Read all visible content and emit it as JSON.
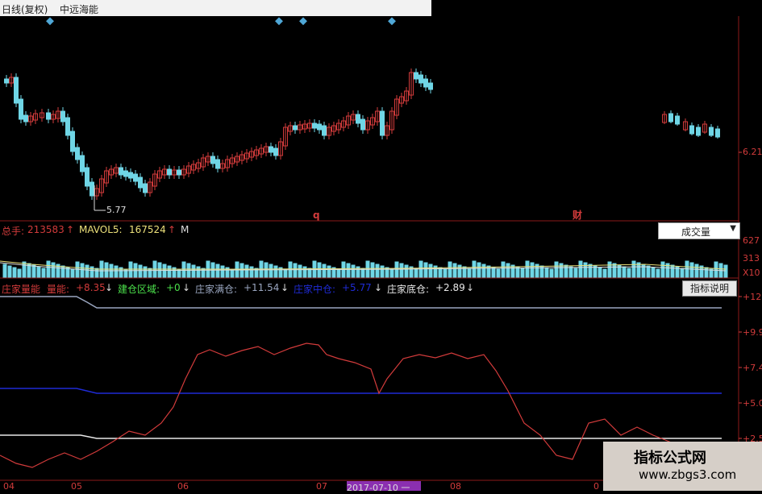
{
  "header": {
    "chart_mode": "日线(复权)",
    "stock_name": "中远海能"
  },
  "main_chart": {
    "low_price_label": "5.77",
    "marker_q": "q",
    "marker_cai": "财",
    "axis_price": "6.21"
  },
  "volume_panel": {
    "total_label": "总手:",
    "total_value": "213583",
    "mavol_label": "MAVOL5:",
    "mavol_value": "167524",
    "m_label": "M",
    "indicator_select": "成交量",
    "axis_top": "627",
    "axis_mid": "313",
    "axis_unit": "X10"
  },
  "indicator_panel": {
    "title": "庄家量能",
    "energy_label": "量能:",
    "energy_value": "+8.35",
    "build_label": "建仓区域:",
    "build_value": "+0",
    "full_label": "庄家满仓:",
    "full_value": "+11.54",
    "mid_label": "庄家中仓:",
    "mid_value": "+5.77",
    "bottom_label": "庄家底仓:",
    "bottom_value": "+2.89",
    "explain_button": "指标说明",
    "axis_labels": [
      "+12.",
      "+9.9",
      "+7.4",
      "+5.0",
      "+2.5"
    ]
  },
  "date_axis": {
    "labels": [
      "04",
      "05",
      "06",
      "07",
      "08",
      "0"
    ],
    "highlight": "2017-07-10 一"
  },
  "watermark": {
    "line1": "指标公式网",
    "line2": "www.zbgs3.com"
  },
  "colors": {
    "up": "#d23b3b",
    "down": "#6fd6e6",
    "bg": "#000000",
    "blue_line": "#1f2bd6",
    "full_line": "#9aa6c0"
  }
}
